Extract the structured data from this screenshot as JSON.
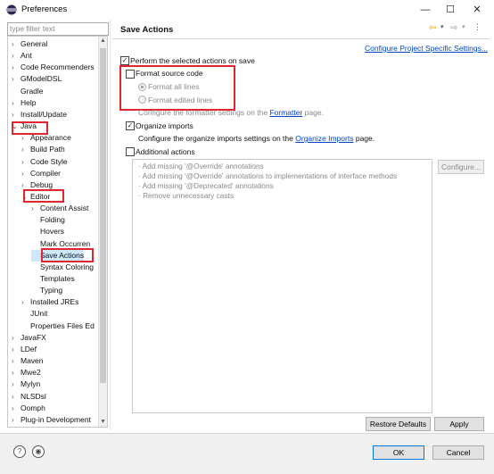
{
  "window": {
    "title": "Preferences",
    "minimize": "—",
    "maximize": "☐",
    "close": "✕"
  },
  "filter": {
    "placeholder": "type filter text"
  },
  "tree": [
    {
      "label": "General",
      "arrow": "›"
    },
    {
      "label": "Ant",
      "arrow": "›"
    },
    {
      "label": "Code Recommenders",
      "arrow": "›"
    },
    {
      "label": "GModelDSL",
      "arrow": "›"
    },
    {
      "label": "Gradle",
      "arrow": ""
    },
    {
      "label": "Help",
      "arrow": "›"
    },
    {
      "label": "Install/Update",
      "arrow": "›"
    },
    {
      "label": "Java",
      "arrow": "⌄"
    },
    {
      "label": "Appearance",
      "arrow": "›"
    },
    {
      "label": "Build Path",
      "arrow": "›"
    },
    {
      "label": "Code Style",
      "arrow": "›"
    },
    {
      "label": "Compiler",
      "arrow": "›"
    },
    {
      "label": "Debug",
      "arrow": "›"
    },
    {
      "label": "Editor",
      "arrow": "⌄"
    },
    {
      "label": "Content Assist",
      "arrow": "›"
    },
    {
      "label": "Folding",
      "arrow": ""
    },
    {
      "label": "Hovers",
      "arrow": ""
    },
    {
      "label": "Mark Occurren",
      "arrow": ""
    },
    {
      "label": "Save Actions",
      "arrow": ""
    },
    {
      "label": "Syntax Coloring",
      "arrow": ""
    },
    {
      "label": "Templates",
      "arrow": ""
    },
    {
      "label": "Typing",
      "arrow": ""
    },
    {
      "label": "Installed JREs",
      "arrow": "›"
    },
    {
      "label": "JUnit",
      "arrow": ""
    },
    {
      "label": "Properties Files Ed",
      "arrow": ""
    },
    {
      "label": "JavaFX",
      "arrow": "›"
    },
    {
      "label": "LDef",
      "arrow": "›"
    },
    {
      "label": "Maven",
      "arrow": "›"
    },
    {
      "label": "Mwe2",
      "arrow": "›"
    },
    {
      "label": "Mylyn",
      "arrow": "›"
    },
    {
      "label": "NLSDsl",
      "arrow": "›"
    },
    {
      "label": "Oomph",
      "arrow": "›"
    },
    {
      "label": "Plug-in Development",
      "arrow": "›"
    }
  ],
  "page": {
    "title": "Save Actions",
    "configure_link": "Configure Project Specific Settings...",
    "perform_label": "Perform the selected actions on save",
    "format_label": "Format source code",
    "format_all": "Format all lines",
    "format_edited": "Format edited lines",
    "formatter_text": "Configure the formatter settings on the",
    "formatter_link": "Formatter",
    "formatter_suffix": "page.",
    "organize_label": "Organize imports",
    "organize_text": "Configure the organize imports settings on the",
    "organize_link": "Organize Imports",
    "organize_suffix": "page.",
    "additional_label": "Additional actions",
    "additional_items": [
      "· Add missing '@Override' annotations",
      "· Add missing '@Override' annotations to implementations of interface methods",
      "· Add missing '@Deprecated' annotations",
      "· Remove unnecessary casts"
    ],
    "configure_button": "Configure...",
    "restore_button": "Restore Defaults",
    "apply_button": "Apply"
  },
  "footer": {
    "ok": "OK",
    "cancel": "Cancel",
    "help_icon": "?",
    "import_icon": "◉"
  },
  "colors": {
    "highlight": "#e0262f",
    "link": "#0046c8",
    "selection": "#cde8ff"
  }
}
